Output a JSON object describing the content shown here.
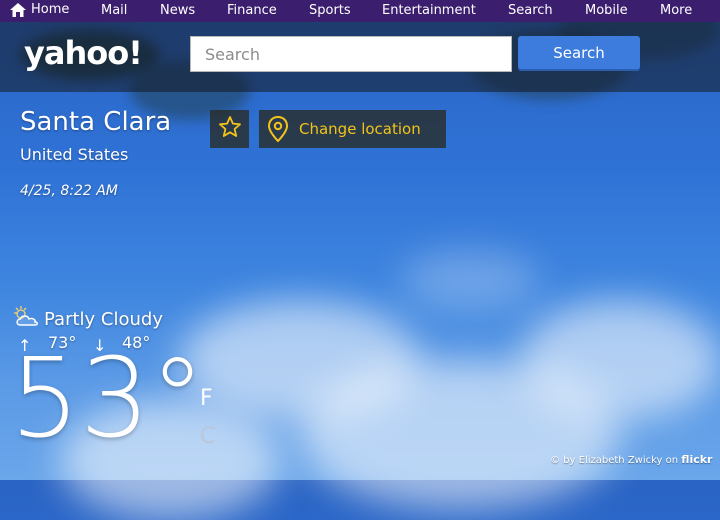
{
  "topnav": {
    "items": [
      "Home",
      "Mail",
      "News",
      "Finance",
      "Sports",
      "Entertainment",
      "Search",
      "Mobile",
      "More"
    ]
  },
  "header": {
    "logo": "yahoo!",
    "search_placeholder": "Search",
    "search_button": "Search"
  },
  "location": {
    "city": "Santa Clara",
    "country": "United States",
    "datetime": "4/25, 8:22 AM",
    "change_location_label": "Change location"
  },
  "weather": {
    "condition": "Partly Cloudy",
    "high": "73°",
    "low": "48°",
    "temperature": "53°",
    "unit_f": "F",
    "unit_c": "C"
  },
  "credit": {
    "text": "© by Elizabeth Zwicky on",
    "brand": "flickr"
  },
  "colors": {
    "nav_bg": "#3b1f6e",
    "search_button": "#3d7cdc",
    "accent_yellow": "#f2c31a"
  },
  "icons": {
    "home": "home-icon",
    "favorite": "star-icon",
    "location": "map-pin-icon",
    "condition": "partly-cloudy-icon",
    "high": "arrow-up-icon",
    "low": "arrow-down-icon"
  }
}
